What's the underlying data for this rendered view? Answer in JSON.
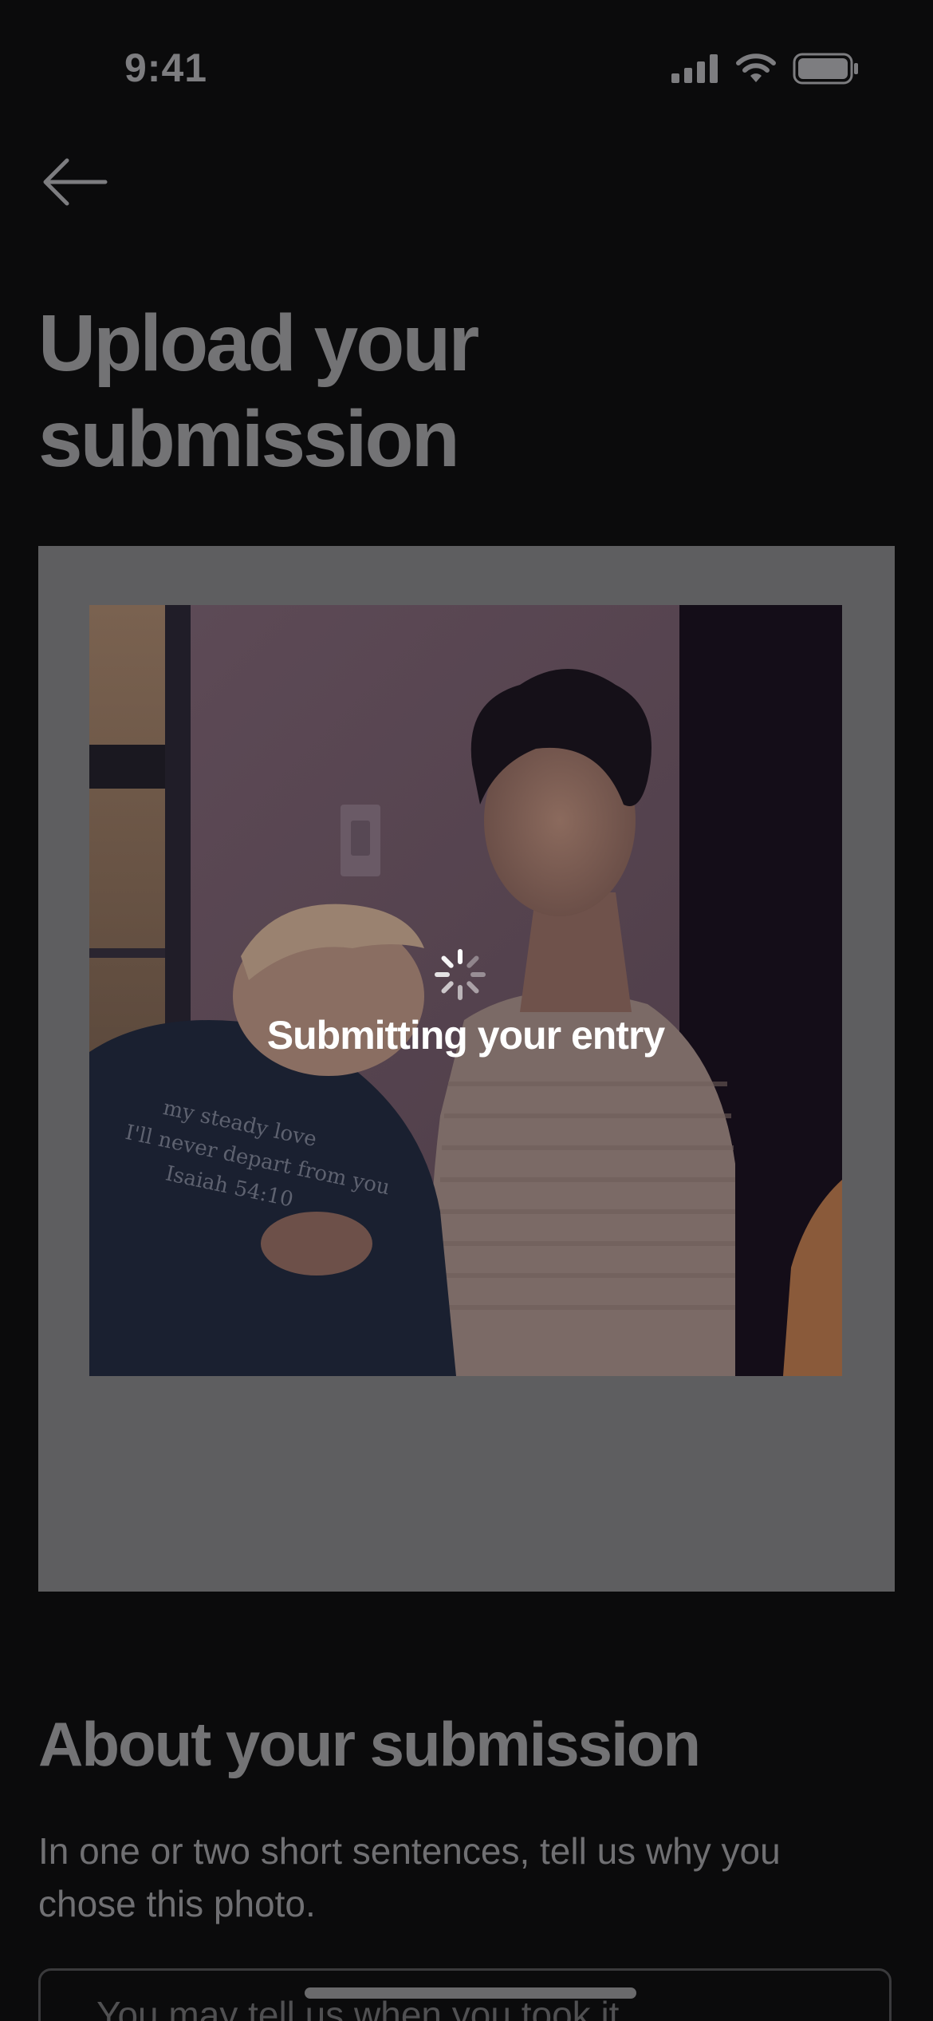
{
  "status_bar": {
    "time": "9:41",
    "icons": [
      "signal-icon",
      "wifi-icon",
      "battery-icon"
    ]
  },
  "header": {
    "back_icon": "arrow-left-icon",
    "title_line1": "Upload your",
    "title_line2": "submission"
  },
  "upload": {
    "loading_text": "Submitting your entry",
    "spinner_icon": "spinner-icon"
  },
  "about": {
    "title": "About your submission",
    "description": "In one or two short sentences, tell us why you chose this photo.",
    "input_placeholder": "You may tell us when you took it"
  },
  "colors": {
    "background": "#0b0b0c",
    "dimmed_text": "#737375",
    "frame": "#5e5e60",
    "overlay_text": "#ffffff"
  }
}
